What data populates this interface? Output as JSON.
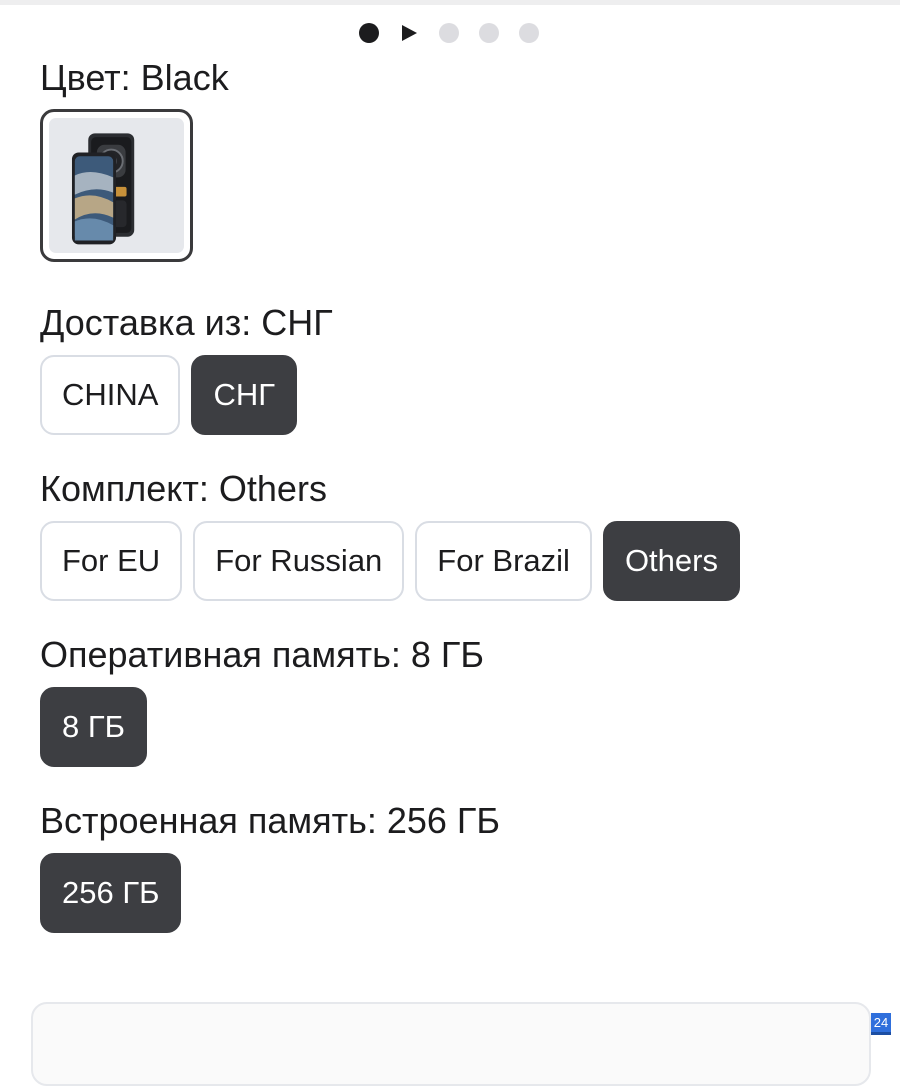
{
  "carousel": {
    "active_index": 0,
    "total": 5
  },
  "color": {
    "label": "Цвет: Black",
    "selected_swatch_image": "rugged-phone-black"
  },
  "delivery": {
    "label": "Доставка из: СНГ",
    "options": [
      {
        "label": "CHINA",
        "selected": false
      },
      {
        "label": "СНГ",
        "selected": true
      }
    ]
  },
  "kit": {
    "label": "Комплект: Others",
    "options": [
      {
        "label": "For EU",
        "selected": false
      },
      {
        "label": "For Russian",
        "selected": false
      },
      {
        "label": "For Brazil",
        "selected": false
      },
      {
        "label": "Others",
        "selected": true
      }
    ]
  },
  "ram": {
    "label": "Оперативная память: 8 ГБ",
    "options": [
      {
        "label": "8 ГБ",
        "selected": true
      }
    ]
  },
  "storage": {
    "label": "Встроенная память: 256 ГБ",
    "options": [
      {
        "label": "256 ГБ",
        "selected": true
      }
    ]
  },
  "corner_badge": "24",
  "colors": {
    "selected_chip": "#3d3e42",
    "chip_border": "#d9dde4",
    "text": "#1c1c1e",
    "inactive_dot": "#dcdce0"
  }
}
